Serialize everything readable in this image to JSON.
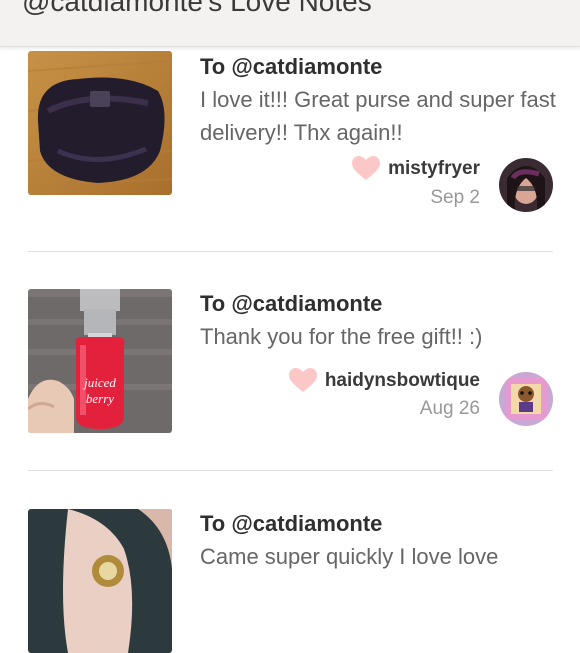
{
  "header": {
    "title": "@catdiamonte's Love Notes"
  },
  "notes": [
    {
      "to": "To @catdiamonte",
      "message": "I love it!!! Great purse and super fast delivery!! Thx again!!",
      "username": "mistyfryer",
      "date": "Sep 2",
      "thumb_icon": "purse-photo",
      "avatar_icon": "user-avatar-photo"
    },
    {
      "to": "To @catdiamonte",
      "message": "Thank you for the free gift!! :)",
      "username": "haidynsbowtique",
      "date": "Aug 26",
      "thumb_icon": "perfume-bottle-photo",
      "thumb_label": "juiced berry",
      "avatar_icon": "user-avatar-photo"
    },
    {
      "to": "To @catdiamonte",
      "message": "Came super quickly I love love",
      "thumb_icon": "ring-photo"
    }
  ],
  "colors": {
    "heart": "#fcc7c7",
    "header_bg": "#f4f2f1",
    "divider": "#e2e0de"
  }
}
